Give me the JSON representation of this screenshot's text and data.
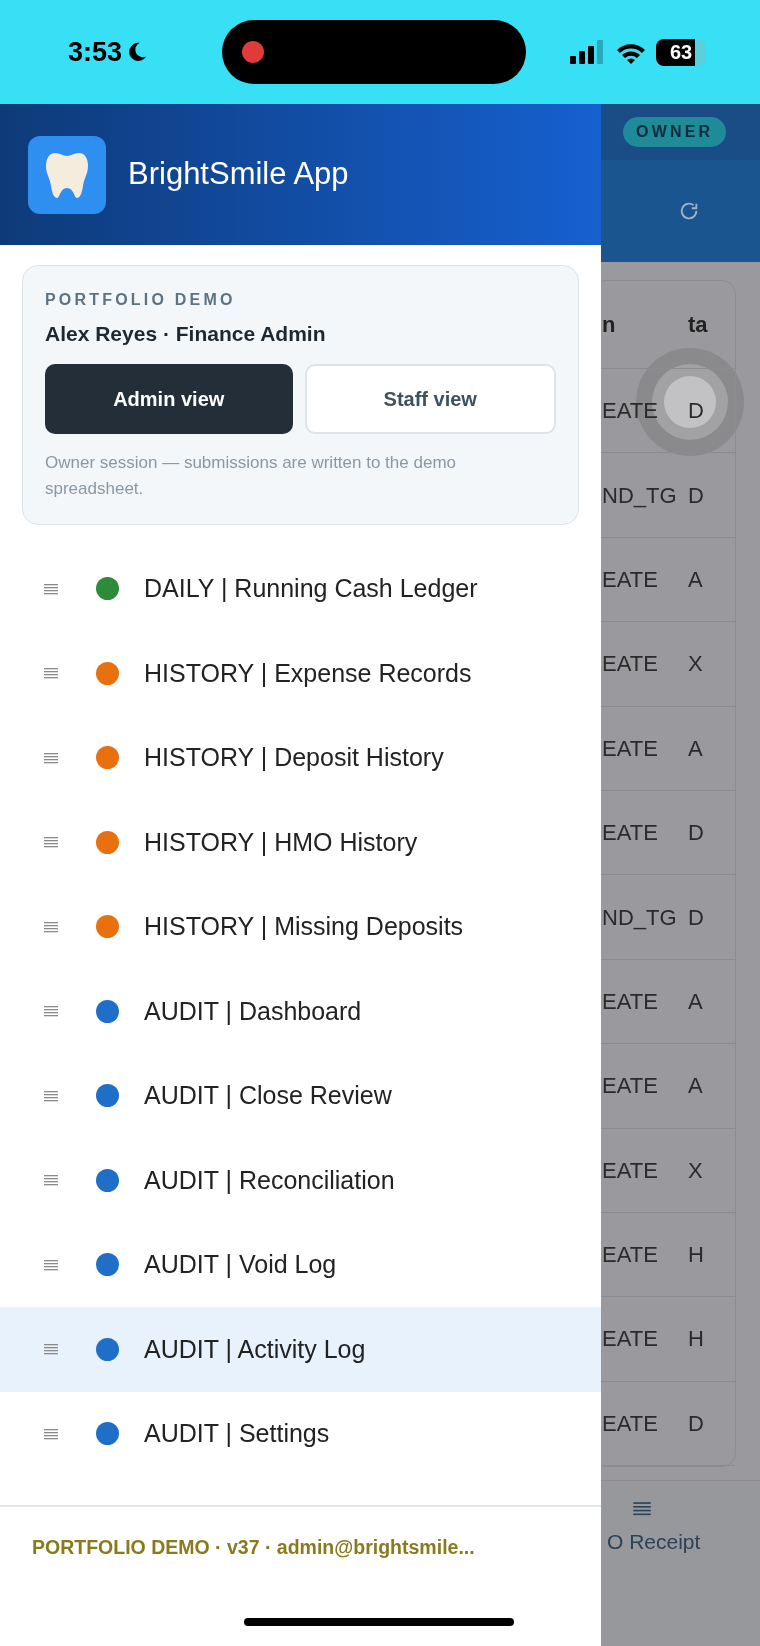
{
  "status_bar": {
    "time": "3:53",
    "battery": "63"
  },
  "drawer": {
    "app_title": "BrightSmile App",
    "account": {
      "label": "PORTFOLIO DEMO",
      "user": "Alex Reyes · Finance Admin",
      "views": [
        {
          "label": "Admin view",
          "selected": true
        },
        {
          "label": "Staff view",
          "selected": false
        }
      ],
      "note": "Owner session — submissions are written to the demo spreadsheet."
    },
    "menu": [
      {
        "label": "DAILY | Running Cash Ledger",
        "color": "#2e8b3a",
        "selected": false
      },
      {
        "label": "HISTORY | Expense Records",
        "color": "#e8700f",
        "selected": false
      },
      {
        "label": "HISTORY | Deposit History",
        "color": "#e8700f",
        "selected": false
      },
      {
        "label": "HISTORY | HMO History",
        "color": "#e8700f",
        "selected": false
      },
      {
        "label": "HISTORY | Missing Deposits",
        "color": "#e8700f",
        "selected": false
      },
      {
        "label": "AUDIT | Dashboard",
        "color": "#1f6fc9",
        "selected": false
      },
      {
        "label": "AUDIT | Close Review",
        "color": "#1f6fc9",
        "selected": false
      },
      {
        "label": "AUDIT | Reconciliation",
        "color": "#1f6fc9",
        "selected": false
      },
      {
        "label": "AUDIT | Void Log",
        "color": "#1f6fc9",
        "selected": false
      },
      {
        "label": "AUDIT | Activity Log",
        "color": "#1f6fc9",
        "selected": true
      },
      {
        "label": "AUDIT | Settings",
        "color": "#1f6fc9",
        "selected": false
      }
    ],
    "footer": "PORTFOLIO DEMO · v37 · admin@brightsmile..."
  },
  "background": {
    "badge": "OWNER",
    "table": {
      "columns": [
        "n",
        "ta"
      ],
      "rows": [
        [
          "EATE",
          "D"
        ],
        [
          "ND_TG",
          "D"
        ],
        [
          "EATE",
          "A"
        ],
        [
          "EATE",
          "X"
        ],
        [
          "EATE",
          "A"
        ],
        [
          "EATE",
          "D"
        ],
        [
          "ND_TG",
          "D"
        ],
        [
          "EATE",
          "A"
        ],
        [
          "EATE",
          "A"
        ],
        [
          "EATE",
          "X"
        ],
        [
          "EATE",
          "H"
        ],
        [
          "EATE",
          "H"
        ],
        [
          "EATE",
          "D"
        ]
      ]
    },
    "bottom_nav": {
      "label": "O Receipt"
    }
  }
}
